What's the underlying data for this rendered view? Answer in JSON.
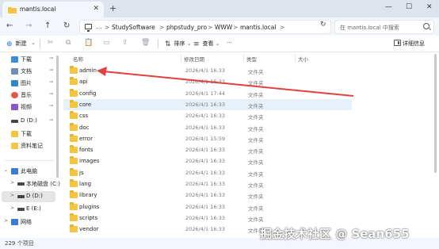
{
  "window": {
    "tab_title": "mantis.local",
    "new_tab": "+",
    "close_tab": "✕",
    "controls": {
      "minimize": "—",
      "maximize": "☐",
      "close": "✕"
    }
  },
  "address": {
    "nav": {
      "back": "←",
      "forward": "→",
      "up": "↑",
      "refresh": "↻"
    },
    "more": "…",
    "breadcrumbs": [
      "StudySoftware",
      "phpstudy_pro",
      "WWW",
      "mantis.local"
    ],
    "separator": ">",
    "search_placeholder": "在 mantis.local 中搜索"
  },
  "toolbar": {
    "new_label": "新建",
    "new_chevron": "⌄",
    "sort_label": "排序",
    "view_label": "查看",
    "chevron": "⌄",
    "more": "···",
    "details_label": "详细信息"
  },
  "sidebar": {
    "items": [
      {
        "label": "下载",
        "icon": "download-icon",
        "pinned": true
      },
      {
        "label": "文档",
        "icon": "documents-icon",
        "pinned": true
      },
      {
        "label": "图片",
        "icon": "pictures-icon",
        "pinned": true
      },
      {
        "label": "音乐",
        "icon": "music-icon",
        "pinned": true
      },
      {
        "label": "视频",
        "icon": "videos-icon",
        "pinned": true
      },
      {
        "label": "D (D:)",
        "icon": "drive-icon",
        "pinned": true
      },
      {
        "label": "下载",
        "icon": "folder-icon",
        "pinned": false
      },
      {
        "label": "资料笔记",
        "icon": "folder-icon",
        "pinned": false
      }
    ],
    "tree": [
      {
        "label": "此电脑",
        "icon": "this-pc-icon",
        "expand": "⌄"
      },
      {
        "label": "本地磁盘 (C:)",
        "icon": "drive-icon",
        "expand": ">"
      },
      {
        "label": "D (D:)",
        "icon": "drive-icon",
        "expand": ">",
        "selected": true
      },
      {
        "label": "E (E:)",
        "icon": "drive-icon",
        "expand": ">"
      },
      {
        "label": "网络",
        "icon": "network-icon",
        "expand": ">"
      }
    ],
    "pin_glyph": "📌"
  },
  "columns": {
    "name": "名称",
    "date": "修改日期",
    "type": "类型",
    "size": "大小"
  },
  "files": [
    {
      "name": "admin",
      "date": "2026/4/1 16:33",
      "type": "文件夹"
    },
    {
      "name": "api",
      "date": "2026/4/1 16:33",
      "type": "文件夹"
    },
    {
      "name": "config",
      "date": "2026/4/1 17:44",
      "type": "文件夹"
    },
    {
      "name": "core",
      "date": "2026/4/1 16:33",
      "type": "文件夹"
    },
    {
      "name": "css",
      "date": "2026/4/1 16:33",
      "type": "文件夹"
    },
    {
      "name": "doc",
      "date": "2026/4/1 16:33",
      "type": "文件夹"
    },
    {
      "name": "error",
      "date": "2026/4/1 15:59",
      "type": "文件夹"
    },
    {
      "name": "fonts",
      "date": "2026/4/1 16:33",
      "type": "文件夹"
    },
    {
      "name": "images",
      "date": "2026/4/1 16:33",
      "type": "文件夹"
    },
    {
      "name": "js",
      "date": "2026/4/1 16:33",
      "type": "文件夹"
    },
    {
      "name": "lang",
      "date": "2026/4/1 16:33",
      "type": "文件夹"
    },
    {
      "name": "library",
      "date": "2026/4/1 16:33",
      "type": "文件夹"
    },
    {
      "name": "plugins",
      "date": "2026/4/1 16:33",
      "type": "文件夹"
    },
    {
      "name": "scripts",
      "date": "2026/4/1 16:33",
      "type": "文件夹"
    },
    {
      "name": "vendor",
      "date": "2026/4/1 16:33",
      "type": "文件夹"
    }
  ],
  "hovered_row": "core",
  "status": {
    "count": "229 个项目"
  },
  "watermark": "掘金技术社区 @ Sean655",
  "colors": {
    "accent": "#1a73e8",
    "folder": "#f4c542",
    "arrow": "#e0413d",
    "hover": "#e7f1fb"
  }
}
